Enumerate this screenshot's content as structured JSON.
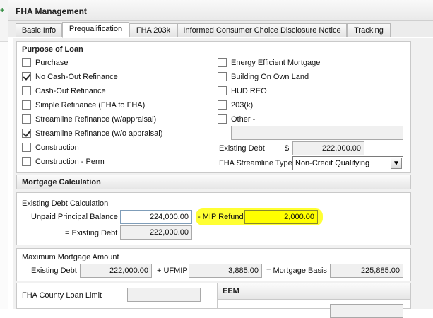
{
  "window": {
    "title": "FHA Management"
  },
  "tabs": [
    {
      "label": "Basic Info"
    },
    {
      "label": "Prequalification"
    },
    {
      "label": "FHA 203k"
    },
    {
      "label": "Informed Consumer Choice Disclosure Notice"
    },
    {
      "label": "Tracking"
    }
  ],
  "purpose": {
    "title": "Purpose of Loan",
    "left_options": [
      {
        "label": "Purchase",
        "checked": false
      },
      {
        "label": "No Cash-Out Refinance",
        "checked": true
      },
      {
        "label": "Cash-Out Refinance",
        "checked": false
      },
      {
        "label": "Simple Refinance (FHA to FHA)",
        "checked": false
      },
      {
        "label": "Streamline Refinance (w/appraisal)",
        "checked": false
      },
      {
        "label": "Streamline Refinance (w/o appraisal)",
        "checked": true
      },
      {
        "label": "Construction",
        "checked": false
      },
      {
        "label": "Construction - Perm",
        "checked": false
      }
    ],
    "right_options": [
      {
        "label": "Energy Efficient Mortgage",
        "checked": false
      },
      {
        "label": "Building On Own Land",
        "checked": false
      },
      {
        "label": "HUD REO",
        "checked": false
      },
      {
        "label": "203(k)",
        "checked": false
      },
      {
        "label": "Other -",
        "checked": false
      }
    ],
    "other_value": "",
    "existing_debt_label": "Existing Debt",
    "currency_symbol": "$",
    "existing_debt_value": "222,000.00",
    "streamline_type_label": "FHA Streamline Type",
    "streamline_type_value": "Non-Credit Qualifying"
  },
  "mortgage_calc": {
    "title": "Mortgage Calculation",
    "existing_debt_calc": {
      "title": "Existing Debt Calculation",
      "upb_label": "Unpaid Principal Balance",
      "upb_value": "224,000.00",
      "mip_refund_label": "- MIP Refund",
      "mip_refund_value": "2,000.00",
      "existing_debt_label": "= Existing Debt",
      "existing_debt_value": "222,000.00"
    },
    "max_mortgage": {
      "title": "Maximum Mortgage Amount",
      "existing_debt_label": "Existing Debt",
      "existing_debt_value": "222,000.00",
      "ufmip_label": "+ UFMIP",
      "ufmip_value": "3,885.00",
      "basis_label": "= Mortgage Basis",
      "basis_value": "225,885.00"
    }
  },
  "county_limit": {
    "label": "FHA County Loan Limit",
    "value": ""
  },
  "eem": {
    "title": "EEM"
  },
  "colors": {
    "highlight": "#ffff33",
    "mip_field": "#ffff00",
    "check_icon": "#2e8b3d"
  }
}
